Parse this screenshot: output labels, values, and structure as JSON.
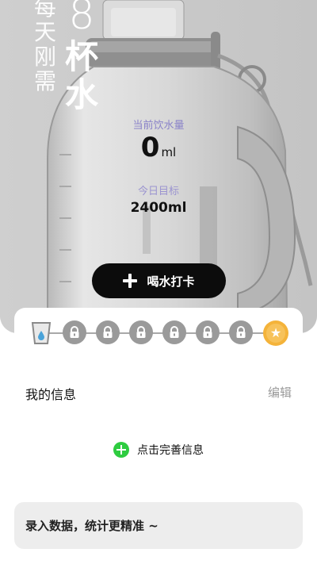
{
  "hero": {
    "slogan": [
      "每",
      "天",
      "刚",
      "需"
    ],
    "cups_number": "8",
    "cups_text": [
      "杯",
      "水"
    ],
    "intake_label": "当前饮水量",
    "intake_value": "0",
    "intake_unit": "ml",
    "goal_label": "今日目标",
    "goal_value": "2400ml",
    "checkin_label": "喝水打卡"
  },
  "progress": {
    "cups_completed": 0,
    "total_nodes": 8,
    "colors": {
      "locked": "#9a9a9a",
      "star": "#f4b33a",
      "cup": "#4aa3d9"
    }
  },
  "info": {
    "title": "我的信息",
    "edit_label": "编辑",
    "complete_label": "点击完善信息"
  },
  "tip": {
    "text": "录入数据，统计更精准 ~"
  }
}
